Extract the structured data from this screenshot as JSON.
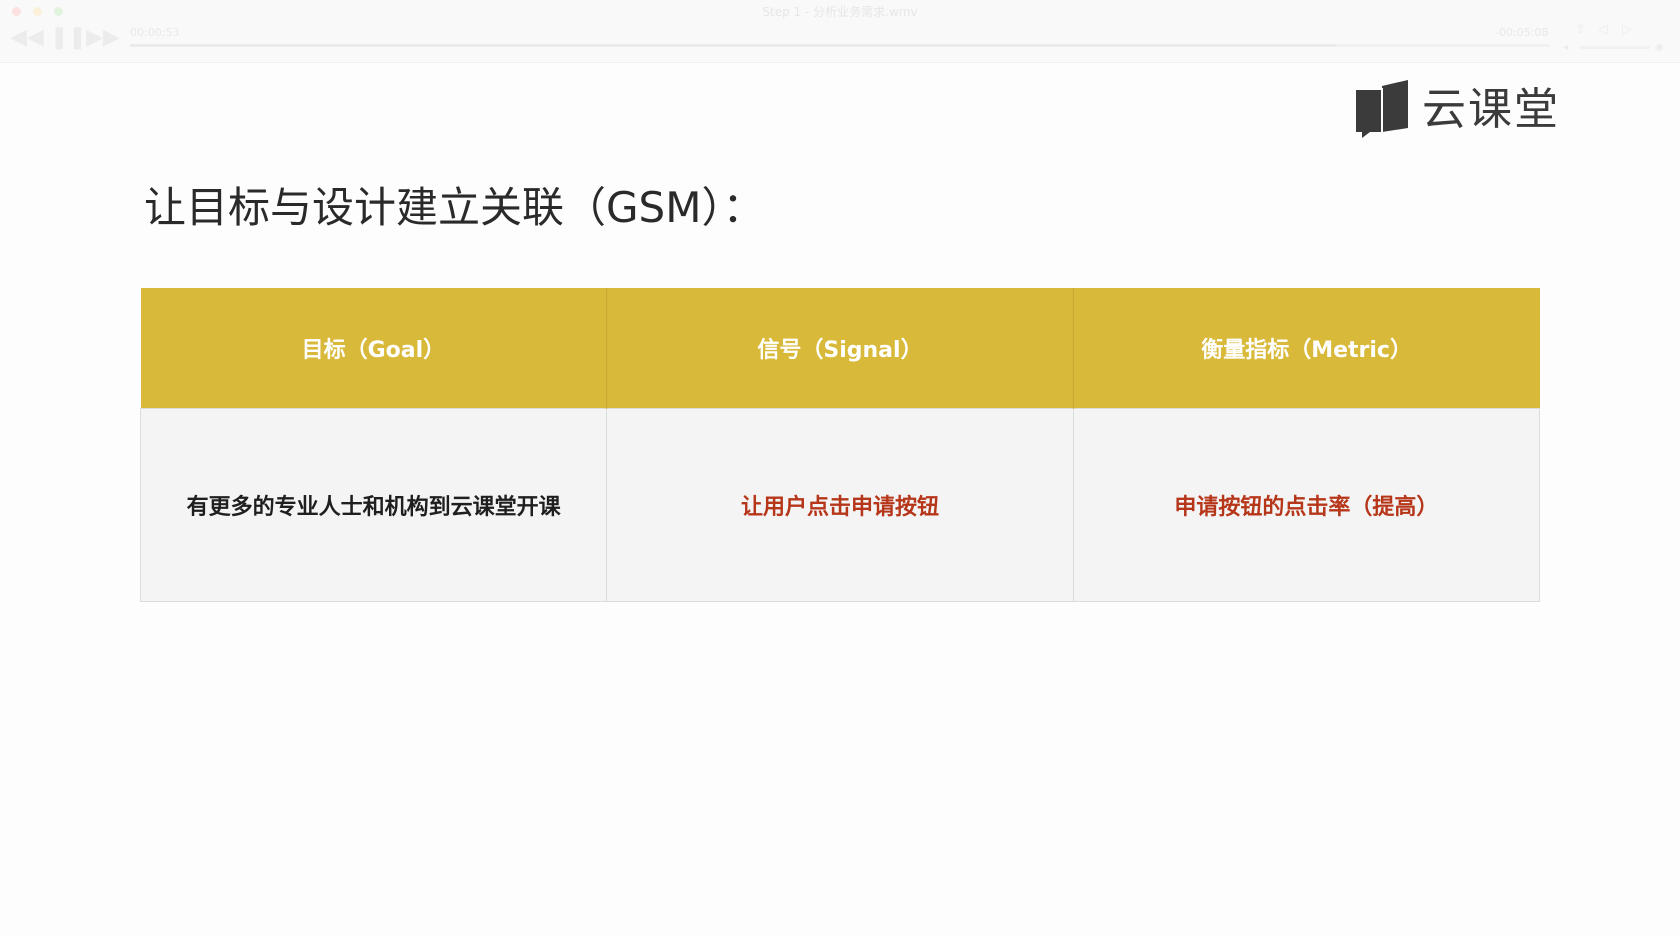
{
  "window": {
    "title": "Step 1 - 分析业务需求.wmv"
  },
  "player": {
    "elapsed": "00:00:53",
    "remaining": "-00:05:08",
    "progress": 0.85,
    "volume": 0.3
  },
  "logo": {
    "text": "云课堂"
  },
  "slide": {
    "title": "让目标与设计建立关联（GSM）："
  },
  "table": {
    "headers": [
      "目标（Goal）",
      "信号（Signal）",
      "衡量指标（Metric）"
    ],
    "rows": [
      [
        "有更多的专业人士和机构到云课堂开课",
        "让用户点击申请按钮",
        "申请按钮的点击率（提高）"
      ]
    ]
  },
  "colors": {
    "header_bg": "#d8b93a",
    "highlight_text": "#b6361a",
    "cell_bg": "#f4f4f4"
  }
}
